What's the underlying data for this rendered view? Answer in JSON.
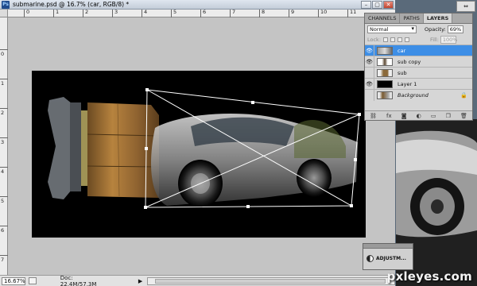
{
  "window": {
    "app_icon": "Ps",
    "title": "submarine.psd @ 16.7% (car, RGB/8) *",
    "buttons": [
      "minimize",
      "maximize",
      "close"
    ]
  },
  "rulers": {
    "top_labels": [
      "0",
      "1",
      "2",
      "3",
      "4",
      "5",
      "6",
      "7",
      "8",
      "9",
      "10",
      "11"
    ],
    "left_labels": [
      "0",
      "1",
      "2",
      "3",
      "4",
      "5",
      "6",
      "7",
      "8"
    ]
  },
  "status": {
    "zoom": "16.67%",
    "doc_info": "Doc: 22.4M/57.3M",
    "arrow": "▶"
  },
  "layers_panel": {
    "tabs": [
      {
        "label": "CHANNELS",
        "active": false
      },
      {
        "label": "PATHS",
        "active": false
      },
      {
        "label": "LAYERS",
        "active": true
      }
    ],
    "blend_mode": "Normal",
    "opacity_label": "Opacity:",
    "opacity_value": "69%",
    "lock_label": "Lock:",
    "fill_label": "Fill:",
    "fill_value": "100%",
    "layers": [
      {
        "name": "car",
        "visible": true,
        "selected": true,
        "italic": false
      },
      {
        "name": "sub copy",
        "visible": true,
        "selected": false,
        "italic": false
      },
      {
        "name": "sub",
        "visible": false,
        "selected": false,
        "italic": false
      },
      {
        "name": "Layer 1",
        "visible": true,
        "selected": false,
        "italic": false
      },
      {
        "name": "Background",
        "visible": false,
        "selected": false,
        "italic": true,
        "locked": true
      }
    ],
    "footer_icons": [
      "link-icon",
      "fx-icon",
      "mask-icon",
      "adjustment-icon",
      "folder-icon",
      "new-layer-icon",
      "trash-icon"
    ]
  },
  "adjustments": {
    "label": "ADJUSTM..."
  },
  "watermark": "pxleyes.com",
  "colors": {
    "selected_layer": "#3d8ee6",
    "canvas_bg": "#c4c4c4"
  }
}
